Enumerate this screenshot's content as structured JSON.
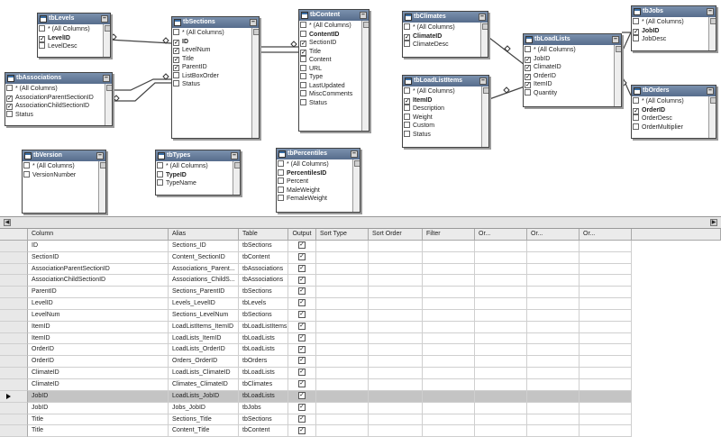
{
  "diagram": {
    "tables": [
      {
        "id": "tbLevels",
        "title": "tbLevels",
        "columns": [
          {
            "name": "* (All Columns)",
            "checked": false,
            "pk": false
          },
          {
            "name": "LevelID",
            "checked": true,
            "pk": true
          },
          {
            "name": "LevelDesc",
            "checked": false,
            "pk": false
          }
        ]
      },
      {
        "id": "tbAssociations",
        "title": "tbAssociations",
        "columns": [
          {
            "name": "* (All Columns)",
            "checked": false,
            "pk": false
          },
          {
            "name": "AssociationParentSectionID",
            "checked": true,
            "pk": false
          },
          {
            "name": "AssociationChildSectionID",
            "checked": true,
            "pk": false
          },
          {
            "name": "Status",
            "checked": false,
            "pk": false
          }
        ]
      },
      {
        "id": "tbSections",
        "title": "tbSections",
        "columns": [
          {
            "name": "* (All Columns)",
            "checked": false,
            "pk": false
          },
          {
            "name": "ID",
            "checked": true,
            "pk": true
          },
          {
            "name": "LevelNum",
            "checked": true,
            "pk": false
          },
          {
            "name": "Title",
            "checked": true,
            "pk": false
          },
          {
            "name": "ParentID",
            "checked": true,
            "pk": false
          },
          {
            "name": "ListBoxOrder",
            "checked": false,
            "pk": false
          },
          {
            "name": "Status",
            "checked": false,
            "pk": false
          }
        ]
      },
      {
        "id": "tbContent",
        "title": "tbContent",
        "columns": [
          {
            "name": "* (All Columns)",
            "checked": false,
            "pk": false
          },
          {
            "name": "ContentID",
            "checked": false,
            "pk": true
          },
          {
            "name": "SectionID",
            "checked": true,
            "pk": false
          },
          {
            "name": "Title",
            "checked": true,
            "pk": false
          },
          {
            "name": "Content",
            "checked": false,
            "pk": false
          },
          {
            "name": "URL",
            "checked": false,
            "pk": false
          },
          {
            "name": "Type",
            "checked": false,
            "pk": false
          },
          {
            "name": "LastUpdated",
            "checked": false,
            "pk": false
          },
          {
            "name": "MiscComments",
            "checked": false,
            "pk": false
          },
          {
            "name": "Status",
            "checked": false,
            "pk": false
          }
        ]
      },
      {
        "id": "tbClimates",
        "title": "tbClimates",
        "columns": [
          {
            "name": "* (All Columns)",
            "checked": false,
            "pk": false
          },
          {
            "name": "ClimateID",
            "checked": true,
            "pk": true
          },
          {
            "name": "ClimateDesc",
            "checked": false,
            "pk": false
          }
        ]
      },
      {
        "id": "tbLoadListItems",
        "title": "tbLoadListItems",
        "columns": [
          {
            "name": "* (All Columns)",
            "checked": false,
            "pk": false
          },
          {
            "name": "ItemID",
            "checked": true,
            "pk": true
          },
          {
            "name": "Description",
            "checked": false,
            "pk": false
          },
          {
            "name": "Weight",
            "checked": false,
            "pk": false
          },
          {
            "name": "Custom",
            "checked": false,
            "pk": false
          },
          {
            "name": "Status",
            "checked": false,
            "pk": false
          }
        ]
      },
      {
        "id": "tbLoadLists",
        "title": "tbLoadLists",
        "columns": [
          {
            "name": "* (All Columns)",
            "checked": false,
            "pk": false
          },
          {
            "name": "JobID",
            "checked": true,
            "pk": false
          },
          {
            "name": "ClimateID",
            "checked": true,
            "pk": false
          },
          {
            "name": "OrderID",
            "checked": true,
            "pk": false
          },
          {
            "name": "ItemID",
            "checked": true,
            "pk": false
          },
          {
            "name": "Quantity",
            "checked": false,
            "pk": false
          }
        ]
      },
      {
        "id": "tbJobs",
        "title": "tbJobs",
        "columns": [
          {
            "name": "* (All Columns)",
            "checked": false,
            "pk": false
          },
          {
            "name": "JobID",
            "checked": true,
            "pk": true
          },
          {
            "name": "JobDesc",
            "checked": false,
            "pk": false
          }
        ]
      },
      {
        "id": "tbOrders",
        "title": "tbOrders",
        "columns": [
          {
            "name": "* (All Columns)",
            "checked": false,
            "pk": false
          },
          {
            "name": "OrderID",
            "checked": true,
            "pk": true
          },
          {
            "name": "OrderDesc",
            "checked": false,
            "pk": false
          },
          {
            "name": "OrderMultiplier",
            "checked": false,
            "pk": false
          }
        ]
      },
      {
        "id": "tbVersion",
        "title": "tbVersion",
        "columns": [
          {
            "name": "* (All Columns)",
            "checked": false,
            "pk": false
          },
          {
            "name": "VersionNumber",
            "checked": false,
            "pk": false
          }
        ]
      },
      {
        "id": "tbTypes",
        "title": "tbTypes",
        "columns": [
          {
            "name": "* (All Columns)",
            "checked": false,
            "pk": false
          },
          {
            "name": "TypeID",
            "checked": false,
            "pk": true
          },
          {
            "name": "TypeName",
            "checked": false,
            "pk": false
          }
        ]
      },
      {
        "id": "tbPercentiles",
        "title": "tbPercentiles",
        "columns": [
          {
            "name": "* (All Columns)",
            "checked": false,
            "pk": false
          },
          {
            "name": "PercentilesID",
            "checked": false,
            "pk": true
          },
          {
            "name": "Percent",
            "checked": false,
            "pk": false
          },
          {
            "name": "MaleWeight",
            "checked": false,
            "pk": false
          },
          {
            "name": "FemaleWeight",
            "checked": false,
            "pk": false
          }
        ]
      }
    ]
  },
  "grid": {
    "headers": [
      "Column",
      "Alias",
      "Table",
      "Output",
      "Sort Type",
      "Sort Order",
      "Filter",
      "Or...",
      "Or...",
      "Or..."
    ],
    "selected_row": 13,
    "rows": [
      {
        "column": "ID",
        "alias": "Sections_ID",
        "table": "tbSections",
        "output": true
      },
      {
        "column": "SectionID",
        "alias": "Content_SectionID",
        "table": "tbContent",
        "output": true
      },
      {
        "column": "AssociationParentSectionID",
        "alias": "Associations_Parent...",
        "table": "tbAssociations",
        "output": true
      },
      {
        "column": "AssociationChildSectionID",
        "alias": "Associations_ChildS...",
        "table": "tbAssociations",
        "output": true
      },
      {
        "column": "ParentID",
        "alias": "Sections_ParentID",
        "table": "tbSections",
        "output": true
      },
      {
        "column": "LevelID",
        "alias": "Levels_LevelID",
        "table": "tbLevels",
        "output": true
      },
      {
        "column": "LevelNum",
        "alias": "Sections_LevelNum",
        "table": "tbSections",
        "output": true
      },
      {
        "column": "ItemID",
        "alias": "LoadListItems_ItemID",
        "table": "tbLoadListItems",
        "output": true
      },
      {
        "column": "ItemID",
        "alias": "LoadLists_ItemID",
        "table": "tbLoadLists",
        "output": true
      },
      {
        "column": "OrderID",
        "alias": "LoadLists_OrderID",
        "table": "tbLoadLists",
        "output": true
      },
      {
        "column": "OrderID",
        "alias": "Orders_OrderID",
        "table": "tbOrders",
        "output": true
      },
      {
        "column": "ClimateID",
        "alias": "LoadLists_ClimateID",
        "table": "tbLoadLists",
        "output": true
      },
      {
        "column": "ClimateID",
        "alias": "Climates_ClimateID",
        "table": "tbClimates",
        "output": true
      },
      {
        "column": "JobID",
        "alias": "LoadLists_JobID",
        "table": "tbLoadLists",
        "output": true
      },
      {
        "column": "JobID",
        "alias": "Jobs_JobID",
        "table": "tbJobs",
        "output": true
      },
      {
        "column": "Title",
        "alias": "Sections_Title",
        "table": "tbSections",
        "output": true
      },
      {
        "column": "Title",
        "alias": "Content_Title",
        "table": "tbContent",
        "output": true
      }
    ]
  },
  "colors": {
    "title_bar": "#566c8c",
    "selected_row": "#c4c4c4",
    "grid_header": "#ebebeb"
  }
}
